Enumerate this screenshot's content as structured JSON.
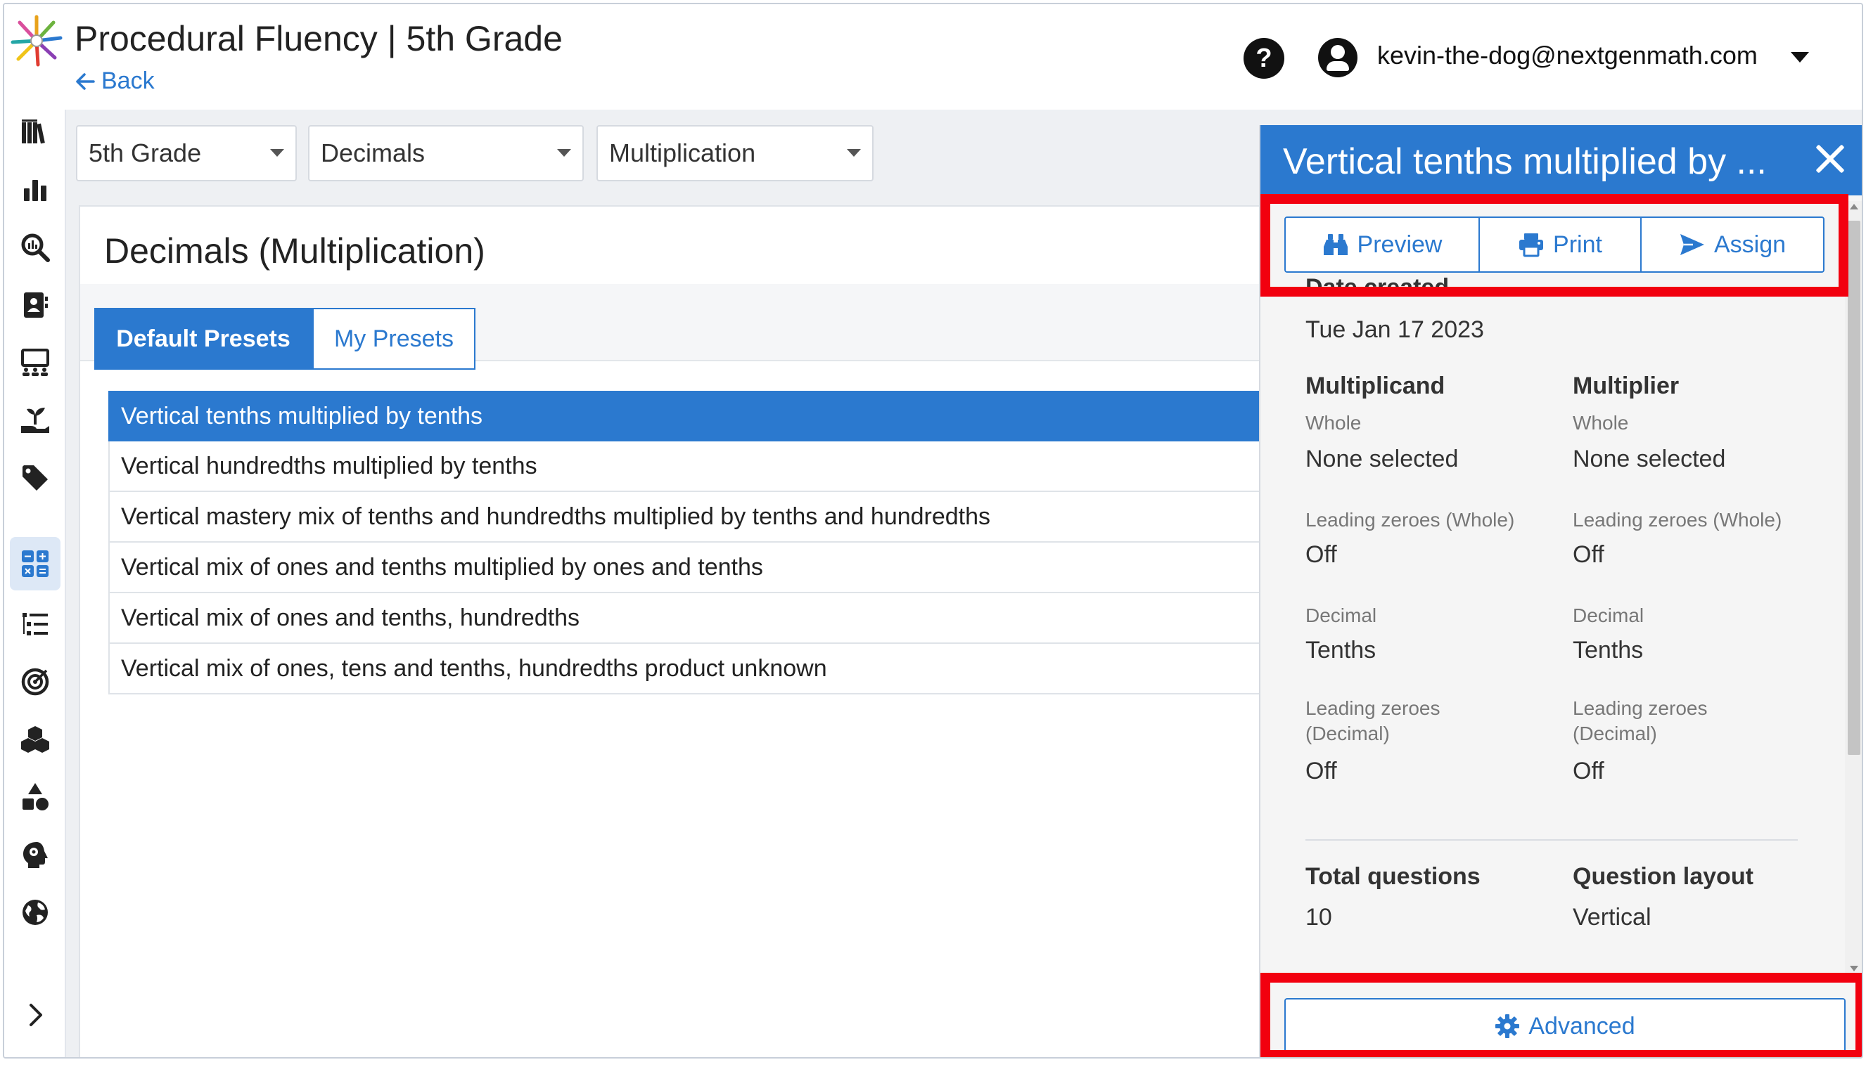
{
  "header": {
    "title": "Procedural Fluency | 5th Grade",
    "back_label": "Back",
    "user_email": "kevin-the-dog@nextgenmath.com",
    "help_label": "?"
  },
  "sidebar": {
    "icons": [
      "library-icon",
      "bar-chart-icon",
      "search-chart-icon",
      "contact-card-icon",
      "classroom-icon",
      "plant-growth-icon",
      "tag-icon",
      "calculator-grid-icon",
      "list-outline-icon",
      "target-icon",
      "cubes-icon",
      "shapes-icon",
      "brain-head-icon",
      "globe-icon",
      "expand-chevron-icon"
    ],
    "active_icon": "calculator-grid-icon"
  },
  "filters": {
    "grade": "5th Grade",
    "topic": "Decimals",
    "operation": "Multiplication"
  },
  "main": {
    "heading": "Decimals (Multiplication)",
    "tabs": [
      {
        "label": "Default Presets",
        "active": true
      },
      {
        "label": "My Presets",
        "active": false
      }
    ],
    "presets": [
      "Vertical tenths multiplied by tenths",
      "Vertical hundredths multiplied by tenths",
      "Vertical mastery mix of tenths and hundredths multiplied by tenths and hundredths",
      "Vertical mix of ones and tenths multiplied by ones and tenths",
      "Vertical mix of ones and tenths, hundredths",
      "Vertical mix of ones, tens and tenths, hundredths product unknown"
    ],
    "selected_index": 0
  },
  "panel": {
    "title": "Vertical tenths multiplied by ...",
    "actions": {
      "preview": "Preview",
      "print": "Print",
      "assign": "Assign"
    },
    "date_created_label": "Date created",
    "date_created_value": "Tue Jan 17 2023",
    "multiplicand": {
      "heading": "Multiplicand",
      "whole_label": "Whole",
      "whole_value": "None selected",
      "lz_whole_label": "Leading zeroes (Whole)",
      "lz_whole_value": "Off",
      "decimal_label": "Decimal",
      "decimal_value": "Tenths",
      "lz_decimal_label_1": "Leading zeroes",
      "lz_decimal_label_2": "(Decimal)",
      "lz_decimal_value": "Off"
    },
    "multiplier": {
      "heading": "Multiplier",
      "whole_label": "Whole",
      "whole_value": "None selected",
      "lz_whole_label": "Leading zeroes (Whole)",
      "lz_whole_value": "Off",
      "decimal_label": "Decimal",
      "decimal_value": "Tenths",
      "lz_decimal_label_1": "Leading zeroes",
      "lz_decimal_label_2": "(Decimal)",
      "lz_decimal_value": "Off"
    },
    "total_questions_label": "Total questions",
    "total_questions_value": "10",
    "question_layout_label": "Question layout",
    "question_layout_value": "Vertical",
    "advanced_label": "Advanced"
  },
  "colors": {
    "accent": "#2b79cf",
    "highlight": "#f2000f",
    "sidebar_active": "#dde8f6"
  }
}
